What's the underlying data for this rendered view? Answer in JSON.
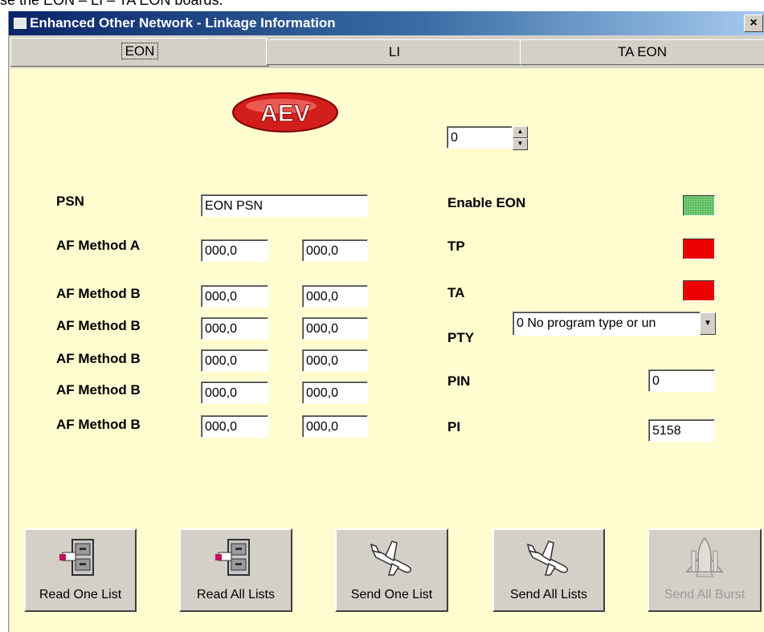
{
  "top_caption": "se the EON – LI – TA EON boards.",
  "window": {
    "title": "Enhanced Other Network - Linkage Information",
    "close_glyph": "×"
  },
  "tabs": [
    {
      "label": "EON",
      "active": true
    },
    {
      "label": "LI",
      "active": false
    },
    {
      "label": "TA EON",
      "active": false
    }
  ],
  "logo": {
    "text": "AEV",
    "color": "#e0231e"
  },
  "spinner": {
    "value": "0"
  },
  "left_fields": {
    "psn": {
      "label": "PSN",
      "value": "EON PSN"
    },
    "af_rows": [
      {
        "label": "AF Method A",
        "value1": "000,0",
        "value2": "000,0"
      },
      {
        "label": "AF Method B",
        "value1": "000,0",
        "value2": "000,0"
      },
      {
        "label": "AF Method B",
        "value1": "000,0",
        "value2": "000,0"
      },
      {
        "label": "AF Method B",
        "value1": "000,0",
        "value2": "000,0"
      },
      {
        "label": "AF Method B",
        "value1": "000,0",
        "value2": "000,0"
      },
      {
        "label": "AF Method B",
        "value1": "000,0",
        "value2": "000,0"
      }
    ]
  },
  "right_fields": {
    "enable_eon": {
      "label": "Enable EON",
      "state": "on",
      "color": "#59b85a"
    },
    "tp": {
      "label": "TP",
      "state": "off",
      "color": "#ee0000"
    },
    "ta": {
      "label": "TA",
      "state": "off",
      "color": "#ee0000"
    },
    "pty": {
      "label": "PTY",
      "selected": "0   No program type or un"
    },
    "pin": {
      "label": "PIN",
      "value": "0"
    },
    "pi": {
      "label": "PI",
      "value": "5158"
    }
  },
  "buttons": [
    {
      "label": "Read One List",
      "icon": "file-cabinet-icon",
      "enabled": true
    },
    {
      "label": "Read All Lists",
      "icon": "file-cabinet-icon",
      "enabled": true
    },
    {
      "label": "Send One List",
      "icon": "airplane-icon",
      "enabled": true
    },
    {
      "label": "Send All Lists",
      "icon": "airplane-icon",
      "enabled": true
    },
    {
      "label": "Send All Burst",
      "icon": "space-shuttle-icon",
      "enabled": false
    }
  ]
}
